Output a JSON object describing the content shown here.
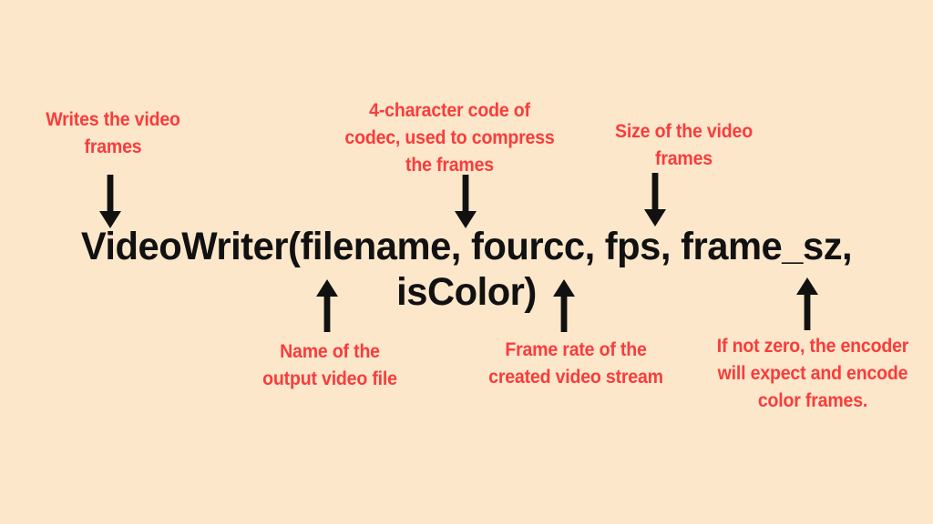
{
  "page": {
    "background_color": "#fce7cb",
    "accent_color": "#f93c3c",
    "code_color": "#111111"
  },
  "signature": {
    "text": "VideoWriter(filename, fourcc, fps, frame_sz, isColor)"
  },
  "annotations": [
    {
      "id": "writes-the-video-frames",
      "text": "Writes the video\nframes",
      "target_param": "VideoWriter",
      "arrow_direction": "down",
      "color": "#f93c3c"
    },
    {
      "id": "fourcc-description",
      "text": "4-character code of\ncodec, used to compress\nthe frames",
      "target_param": "fourcc",
      "arrow_direction": "down",
      "color": "#f93c3c"
    },
    {
      "id": "frame-sz-description",
      "text": "Size of the video\nframes",
      "target_param": "frame_sz",
      "arrow_direction": "down",
      "color": "#f93c3c"
    },
    {
      "id": "filename-description",
      "text": "Name of the\noutput video file",
      "target_param": "filename",
      "arrow_direction": "up",
      "color": "#f93c3c"
    },
    {
      "id": "fps-description",
      "text": "Frame rate of the\ncreated video stream",
      "target_param": "fps",
      "arrow_direction": "up",
      "color": "#f93c3c"
    },
    {
      "id": "iscolor-description",
      "text": "If not zero, the encoder\nwill expect and encode\ncolor frames.",
      "target_param": "isColor",
      "arrow_direction": "up",
      "color": "#f93c3c"
    }
  ],
  "arrows": [
    {
      "id": "arrow-to-videowriter",
      "direction": "down"
    },
    {
      "id": "arrow-to-fourcc",
      "direction": "down"
    },
    {
      "id": "arrow-to-frame-sz",
      "direction": "down"
    },
    {
      "id": "arrow-to-filename",
      "direction": "up"
    },
    {
      "id": "arrow-to-fps",
      "direction": "up"
    },
    {
      "id": "arrow-to-iscolor",
      "direction": "up"
    }
  ]
}
